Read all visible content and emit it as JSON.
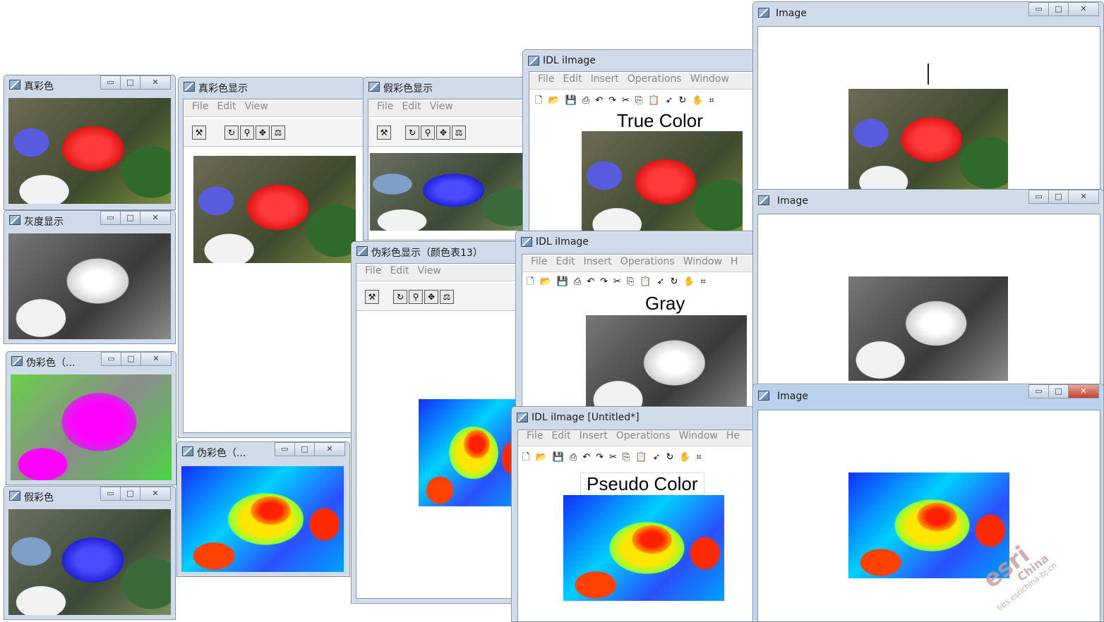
{
  "windows": {
    "small_true": {
      "title": "真彩色"
    },
    "small_gray": {
      "title": "灰度显示"
    },
    "small_pseudo": {
      "title": "伪彩色（..."
    },
    "small_false": {
      "title": "假彩色"
    },
    "true_display": {
      "title": "真彩色显示"
    },
    "false_display": {
      "title": "假彩色显示"
    },
    "pseudo_display": {
      "title": "伪彩色显示（颜色表13）"
    },
    "pseudo_small2": {
      "title": "伪彩色（..."
    },
    "idl_true": {
      "title": "IDL iImage",
      "plot_title": "True Color"
    },
    "idl_gray": {
      "title": "IDL iImage",
      "plot_title": "Gray"
    },
    "idl_pseudo": {
      "title": "IDL iImage [Untitled*]",
      "plot_title": "Pseudo Color"
    },
    "image_1": {
      "title": "Image"
    },
    "image_2": {
      "title": "Image"
    },
    "image_3": {
      "title": "Image"
    }
  },
  "simple_menu": {
    "file": "File",
    "edit": "Edit",
    "view": "View"
  },
  "idl_menu": {
    "file": "File",
    "edit": "Edit",
    "insert": "Insert",
    "operations": "Operations",
    "window": "Window",
    "help_partial": "H",
    "help_partial2": "He"
  },
  "window_controls": {
    "minimize": "▭",
    "maximize": "□",
    "close": "✕"
  },
  "watermark": {
    "brand": "esri",
    "region": "China",
    "url": "bbs.esrichina-bj.cn"
  },
  "icons": [
    "window-app-icon",
    "open-icon",
    "save-icon",
    "print-icon",
    "undo-icon",
    "redo-icon",
    "cut-icon",
    "copy-icon",
    "paste-icon",
    "select-arrow-icon",
    "rotate-icon",
    "zoom-icon",
    "pan-icon",
    "crop-icon"
  ]
}
